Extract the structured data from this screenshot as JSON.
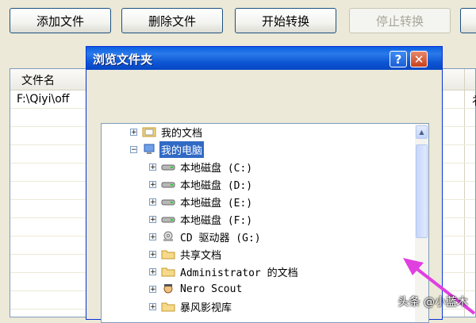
{
  "toolbar": {
    "add_label": "添加文件",
    "delete_label": "删除文件",
    "start_label": "开始转换",
    "stop_label": "停止转换"
  },
  "table": {
    "col_filename": "文件名",
    "row1_path": "F:\\Qiyi\\off",
    "right_col_char": "衤"
  },
  "dialog": {
    "title": "浏览文件夹",
    "help_glyph": "?",
    "close_glyph": "✕"
  },
  "tree": {
    "items": [
      {
        "label": "我的文档"
      },
      {
        "label": "我的电脑"
      },
      {
        "label": "本地磁盘 (C:)"
      },
      {
        "label": "本地磁盘 (D:)"
      },
      {
        "label": "本地磁盘 (E:)"
      },
      {
        "label": "本地磁盘 (F:)"
      },
      {
        "label": "CD 驱动器 (G:)"
      },
      {
        "label": "共享文档"
      },
      {
        "label": "Administrator 的文档"
      },
      {
        "label": "Nero Scout"
      },
      {
        "label": "暴风影视库"
      }
    ]
  },
  "watermark": "头条 @小蓝木",
  "colors": {
    "accent": "#316ac5",
    "title_bar": "#0a5fe1",
    "arrow": "#e040e0"
  }
}
